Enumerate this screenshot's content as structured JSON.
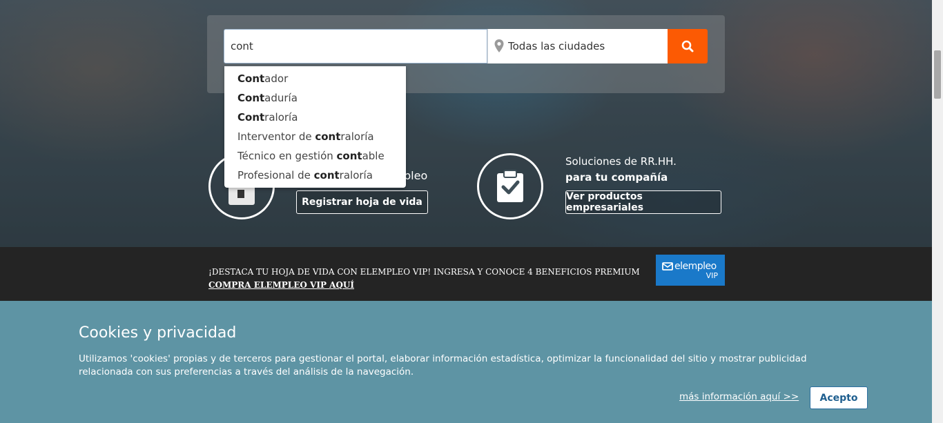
{
  "search": {
    "query_value": "cont",
    "city_placeholder": "Todas las ciudades"
  },
  "autocomplete": {
    "items": [
      {
        "match": "Cont",
        "rest": "ador",
        "prefix": ""
      },
      {
        "match": "Cont",
        "rest": "aduría",
        "prefix": ""
      },
      {
        "match": "Cont",
        "rest": "raloría",
        "prefix": ""
      },
      {
        "prefix": "Interventor de ",
        "match": "cont",
        "rest": "raloría"
      },
      {
        "prefix": "Técnico en gestión ",
        "match": "cont",
        "rest": "able"
      },
      {
        "prefix": "Profesional de ",
        "match": "cont",
        "rest": "raloría"
      }
    ]
  },
  "features": {
    "candidate": {
      "title_partial": "pleo",
      "button": "Registrar hoja de vida"
    },
    "company": {
      "title_line1": "Soluciones de RR.HH.",
      "title_line2": "para tu compañía",
      "button": "Ver productos empresariales"
    }
  },
  "promo": {
    "text": "¡DESTACA TU HOJA DE VIDA CON ELEMPLEO VIP! INGRESA Y CONOCE 4 BENEFICIOS PREMIUM",
    "link": "COMPRA ELEMPLEO VIP AQUÍ",
    "badge_logo": "elempleo",
    "badge_vip": "VIP"
  },
  "cookies": {
    "title": "Cookies y privacidad",
    "body": "Utilizamos 'cookies' propias y de terceros para gestionar el portal, elaborar información estadística, optimizar la funcionalidad del sitio y mostrar publicidad relacionada con sus preferencias a través del análisis de la navegación.",
    "more_link": "más información aquí >>",
    "accept_button": "Acepto"
  },
  "colors": {
    "search_button": "#fc5a03",
    "cookie_band": "#5e94a4",
    "promo_band": "#242424",
    "vip_badge": "#1a79c9"
  },
  "icons": {
    "search": "search-icon",
    "location": "location-pin-icon",
    "clipboard": "clipboard-check-icon",
    "cv": "document-icon",
    "mail": "envelope-icon"
  }
}
